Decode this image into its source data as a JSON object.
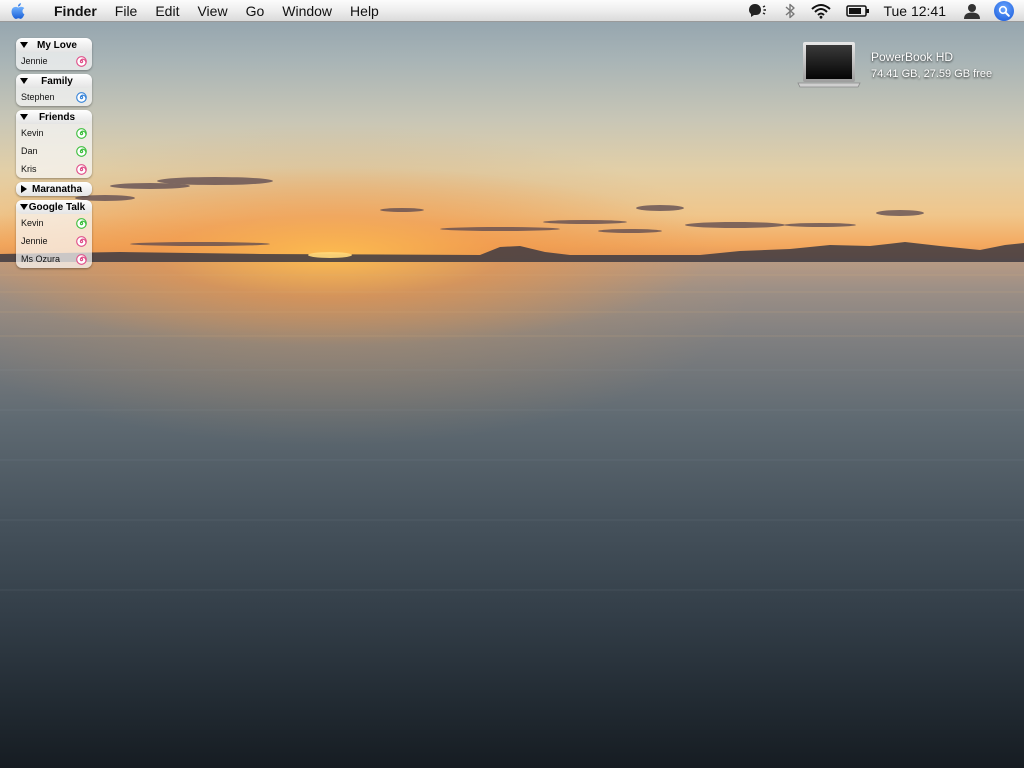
{
  "menubar": {
    "app_name": "Finder",
    "menus": [
      "File",
      "Edit",
      "View",
      "Go",
      "Window",
      "Help"
    ],
    "clock": "Tue 12:41",
    "status_icons": [
      "speech-icon",
      "bluetooth-icon",
      "wifi-icon",
      "battery-icon",
      "user-icon",
      "spotlight-icon"
    ]
  },
  "buddy_list": {
    "groups": [
      {
        "name": "My Love",
        "expanded": true,
        "buddies": [
          {
            "name": "Jennie",
            "color": "#e0508a"
          }
        ]
      },
      {
        "name": "Family",
        "expanded": true,
        "buddies": [
          {
            "name": "Stephen",
            "color": "#3a86d9"
          }
        ]
      },
      {
        "name": "Friends",
        "expanded": true,
        "buddies": [
          {
            "name": "Kevin",
            "color": "#3fbf3f"
          },
          {
            "name": "Dan",
            "color": "#3fbf3f"
          },
          {
            "name": "Kris",
            "color": "#e0508a"
          }
        ]
      },
      {
        "name": "Maranatha",
        "expanded": false,
        "buddies": []
      },
      {
        "name": "Google Talk",
        "expanded": true,
        "buddies": [
          {
            "name": "Kevin",
            "color": "#3fbf3f"
          },
          {
            "name": "Jennie",
            "color": "#e0508a"
          },
          {
            "name": "Ms Ozura",
            "color": "#e0508a"
          }
        ]
      }
    ]
  },
  "desktop": {
    "drive": {
      "name": "PowerBook HD",
      "info": "74.41 GB, 27.59 GB free"
    }
  }
}
